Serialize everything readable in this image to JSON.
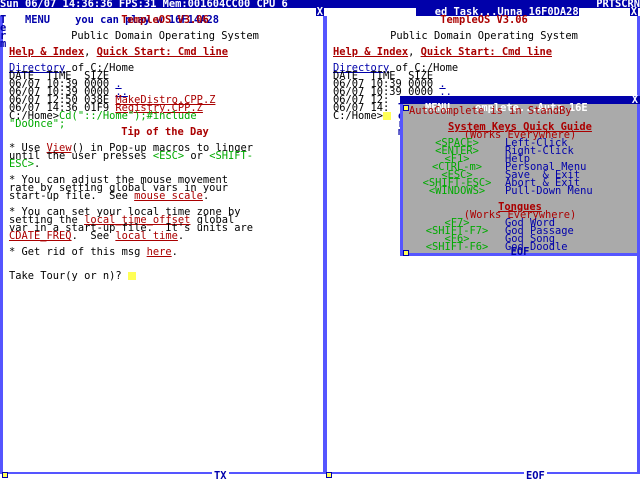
{
  "topbar": {
    "left": "Sun 06/07 14:36:36 FPS:31 Mem:001604CC00 CPU 6",
    "right": "PRTSCRN"
  },
  "left_window": {
    "title": "MENU    you can play w 16F14A28",
    "close": "X",
    "side_label": "Term",
    "header": "TempleOS V3.06",
    "subheader": "Public Domain Operating System",
    "help_link": "Help & Index",
    "quickstart_link": "Quick Start: Cmd line",
    "dir_label": "Directory",
    "dir_path": " of C:/Home",
    "dir_cols": "DATE  TIME  SIZE",
    "files": [
      {
        "date": "06/07 10:39 0000",
        "name": "."
      },
      {
        "date": "06/07 10:39 0000",
        "name": ".."
      },
      {
        "date": "06/07 12:50 038E",
        "name": "MakeDistro.CPP.Z"
      },
      {
        "date": "06/07 14:36 01F9",
        "name": "Registry.CPP.Z"
      }
    ],
    "prompt": "C:/Home>",
    "cmd": "Cd(\"::/Home\");#include",
    "cmd2": "\"DoOnce\";",
    "tip_title": "Tip of the Day",
    "tip1_a": "* Use ",
    "tip1_link": "View",
    "tip1_b": "() in Pop-up macros to linger",
    "tip1_c": "until the user presses ",
    "tip1_esc": "<ESC>",
    "tip1_d": " or ",
    "tip1_shift": "<SHIFT-",
    "tip1_e": "ESC>",
    "tip1_f": ".",
    "tip2_a": "* You can adjust the mouse movement",
    "tip2_b": "rate by setting global vars in your",
    "tip2_c": "start-up file.  See ",
    "tip2_link": "mouse scale",
    "tip2_d": ".",
    "tip3_a": "* You can set your local time zone by",
    "tip3_b": "setting the ",
    "tip3_link": "local_time_offset",
    "tip3_c": " global",
    "tip3_d": "var in a start-up file.  It's units are",
    "tip3_link2": "CDATE_FREQ",
    "tip3_e": ".  See ",
    "tip3_link3": "local time",
    "tip3_f": ".",
    "tip4_a": "* Get rid of this msg ",
    "tip4_link": "here",
    "tip4_b": ".",
    "tour": "Take Tour(y or n)? ",
    "footer": "TX"
  },
  "right_window": {
    "title": "   ed Task...Unna 16F0DA28",
    "close": "X",
    "side_label": "Term",
    "header": "TempleOS V3.06",
    "subheader": "Public Domain Operating System",
    "help_link": "Help & Index",
    "quickstart_link": "Quick Start: Cmd line",
    "dir_label": "Directory",
    "dir_path": " of C:/Home",
    "dir_cols": "DATE  TIME  SIZE",
    "files": [
      {
        "date": "06/07 10:39 0000",
        "name": "."
      },
      {
        "date": "06/07 10:39 0000",
        "name": ".."
      },
      {
        "date": "06/07 12:",
        "name": ""
      },
      {
        "date": "06/07 14:",
        "name": ""
      }
    ],
    "prompt": "C:/Home>",
    "footer": "EOF"
  },
  "popup": {
    "title": "MENU    omplete...Auto 16E",
    "close": "X",
    "standby": "AutoComplete is in StandBy",
    "guide_title": "System Keys Quick Guide",
    "guide_sub": "(Works Everywhere)",
    "keys": [
      {
        "key": "<SPACE>",
        "action": "Left-Click"
      },
      {
        "key": "<ENTER>",
        "action": "Right-Click"
      },
      {
        "key": "<F1>",
        "action": "Help"
      },
      {
        "key": "<CTRL-m>",
        "action": "Personal Menu"
      },
      {
        "key": "<ESC>",
        "action": "Save  & Exit"
      },
      {
        "key": "<SHIFT-ESC>",
        "action": "Abort & Exit"
      },
      {
        "key": "<WINDOWS>",
        "action": "Pull-Down Menu"
      }
    ],
    "tongues_title": "Tongues",
    "tongues_sub": "(Works Everywhere)",
    "tongues": [
      {
        "key": "<F7>",
        "action": "God Word"
      },
      {
        "key": "<SHIFT-F7>",
        "action": "God Passage"
      },
      {
        "key": "<F6>",
        "action": "God Song"
      },
      {
        "key": "<SHIFT-F6>",
        "action": "God Doodle"
      }
    ],
    "footer": "EOF"
  },
  "colors": {
    "border": "#5555ff",
    "titlebar": "#0000aa",
    "link": "#aa0000",
    "key": "#00aa00",
    "popup_bg": "#aaaaaa",
    "cursor": "#ffff55"
  }
}
